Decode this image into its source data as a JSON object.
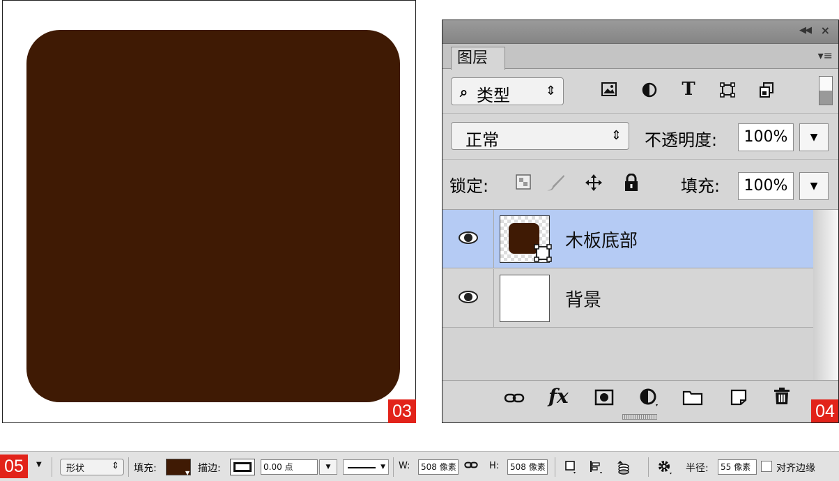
{
  "canvas": {
    "shape_color": "#3f1a04",
    "badge": "03"
  },
  "layers_panel": {
    "badge": "04",
    "titlebar": {
      "collapse_icon": "double-chevron-left-icon",
      "close_icon": "close-icon"
    },
    "tab_label": "图层",
    "filter": {
      "label": "类型",
      "arrows": "⇕"
    },
    "blend_mode": "正常",
    "opacity_label": "不透明度:",
    "opacity_value": "100%",
    "lock_label": "锁定:",
    "fill_label": "填充:",
    "fill_value": "100%",
    "layers": [
      {
        "name": "木板底部",
        "thumb_color": "#3f1a04",
        "selected": true
      },
      {
        "name": "背景",
        "thumb_color": "#ffffff",
        "selected": false
      }
    ],
    "footer_icons": [
      "link-icon",
      "fx-icon",
      "mask-icon",
      "adjustment-icon",
      "folder-icon",
      "new-layer-icon",
      "trash-icon"
    ],
    "fx_label": "fx"
  },
  "options_bar": {
    "badge": "05",
    "mode_value": "形状",
    "fill_label": "填充:",
    "fill_color": "#3f1a04",
    "stroke_label": "描边:",
    "stroke_width": "0.00 点",
    "w_label": "W:",
    "w_value": "508 像素",
    "h_label": "H:",
    "h_value": "508 像素",
    "radius_label": "半径:",
    "radius_value": "55 像素",
    "align_edges_label": "对齐边缘"
  }
}
